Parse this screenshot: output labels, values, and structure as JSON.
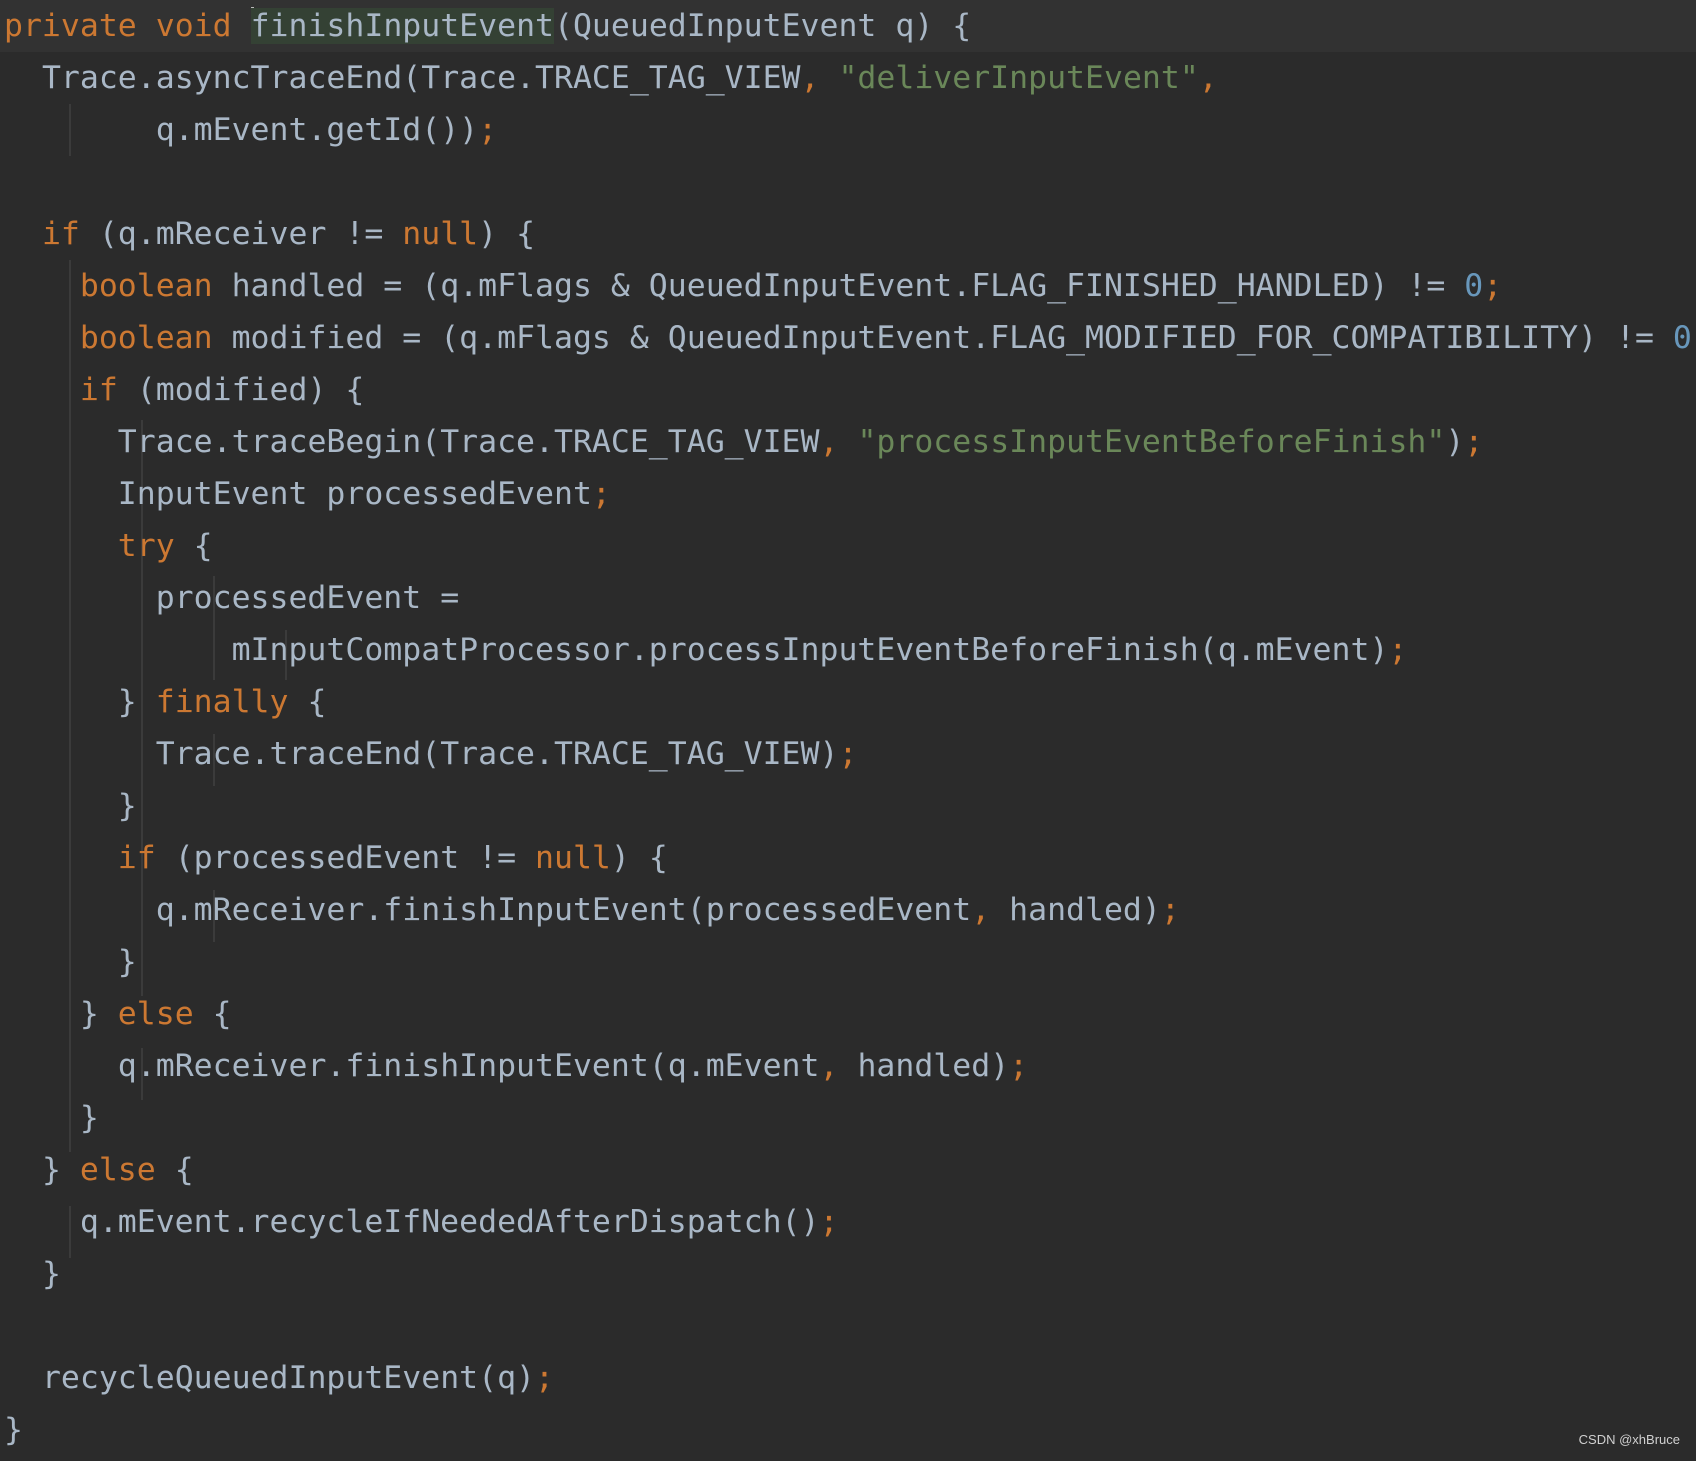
{
  "code": {
    "method_signature": {
      "modifier": "private",
      "return_type": "void",
      "method_name": "finishInputEvent",
      "params": "(QueuedInputEvent q) {"
    },
    "l2_call": "Trace.asyncTraceEnd(Trace.TRACE_TAG_VIEW",
    "l2_comma": ", ",
    "l2_string": "\"deliverInputEvent\"",
    "l2_end": ",",
    "l3_code": "q.mEvent.getId())",
    "semicolon": ";",
    "l5_if": "if",
    "l5_open": " (q.mReceiver != ",
    "null_kw": "null",
    "l5_close": ") {",
    "boolean_kw": "boolean",
    "l6_code": " handled = (q.mFlags & QueuedInputEvent.FLAG_FINISHED_HANDLED) != ",
    "zero": "0",
    "l7_code": " modified = (q.mFlags & QueuedInputEvent.FLAG_MODIFIED_FOR_COMPATIBILITY) != ",
    "if_kw": "if",
    "l8_code": " (modified) {",
    "l9_call": "Trace.traceBegin(Trace.TRACE_TAG_VIEW",
    "l9_comma": ", ",
    "l9_string": "\"processInputEventBeforeFinish\"",
    "l9_end": ")",
    "l10_code": "InputEvent processedEvent",
    "try_kw": "try",
    "open_brace": " {",
    "l12_code": "processedEvent =",
    "l13_code": "mInputCompatProcessor.processInputEventBeforeFinish(q.mEvent)",
    "close_brace": "}",
    "finally_kw": "finally",
    "l15_code": "Trace.traceEnd(Trace.TRACE_TAG_VIEW)",
    "l17_open": " (processedEvent != ",
    "l18_code_a": "q.mReceiver.finishInputEvent(processedEvent",
    "l18_comma": ", ",
    "l18_code_b": "handled)",
    "else_kw": "else",
    "l21_code_a": "q.mReceiver.finishInputEvent(q.mEvent",
    "l21_comma": ", ",
    "l21_code_b": "handled)",
    "l24_code": "q.mEvent.recycleIfNeededAfterDispatch()",
    "l27_code": "recycleQueuedInputEvent(q)"
  },
  "watermark": "CSDN @xhBruce",
  "colors": {
    "background": "#2b2b2b",
    "keyword": "#cc7832",
    "string": "#6a8759",
    "number": "#6897bb",
    "text": "#a9b7c6",
    "method_highlight": "#344134"
  }
}
